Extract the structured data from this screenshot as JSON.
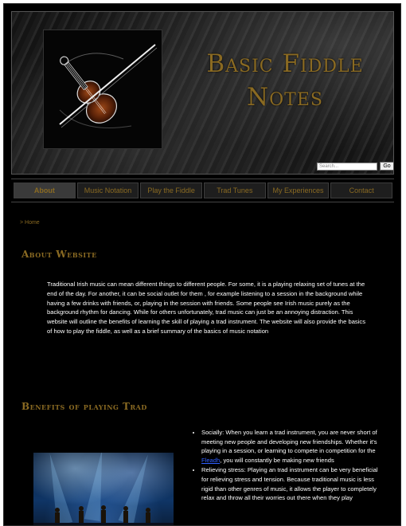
{
  "header": {
    "title_line1": "Basic Fiddle",
    "title_line2": "Notes",
    "search_placeholder": "Search...",
    "search_button": "Go"
  },
  "nav": {
    "items": [
      {
        "label": "About"
      },
      {
        "label": "Music Notation"
      },
      {
        "label": "Play the Fiddle"
      },
      {
        "label": "Trad Tunes"
      },
      {
        "label": "My Experiences"
      },
      {
        "label": "Contact"
      }
    ]
  },
  "breadcrumb": "> Home",
  "about": {
    "heading": "About Website",
    "text": "Traditional Irish music can mean different things to different people. For some, it is a playing relaxing set of tunes at the end of the day. For another, it can be social outlet for them , for example listening to a session in the background while having a few drinks with friends, or, playing in the session with friends. Some people see Irish music purely as the background rhythm for dancing. While for others unfortunately, trad music can just be an annoying distraction. This website will outline the benefits of learning the skill of playing a trad instrument. The website will also provide the basics of how to play the fiddle, as well as a brief summary of the basics of music notation"
  },
  "benefits": {
    "heading": "Benefits of playing Trad",
    "item1_before": "Socially: When you learn a trad instrument, you are never short of meeting new people and developing new friendships. Whether it's playing in a session, or learning to compete in competition for the ",
    "item1_link": "Fleadh",
    "item1_after": ", you will constantly be making new friends",
    "item2": "Relieving stress: Playing an trad instrument can be very beneficial for relieving stress and tension. Because traditional music is less rigid than other genres of music, it allows the player to completely relax and throw all their worries out there when they play"
  },
  "colors": {
    "accent_gold": "#8a6a22",
    "background": "#000000",
    "link": "#2f5fff"
  }
}
